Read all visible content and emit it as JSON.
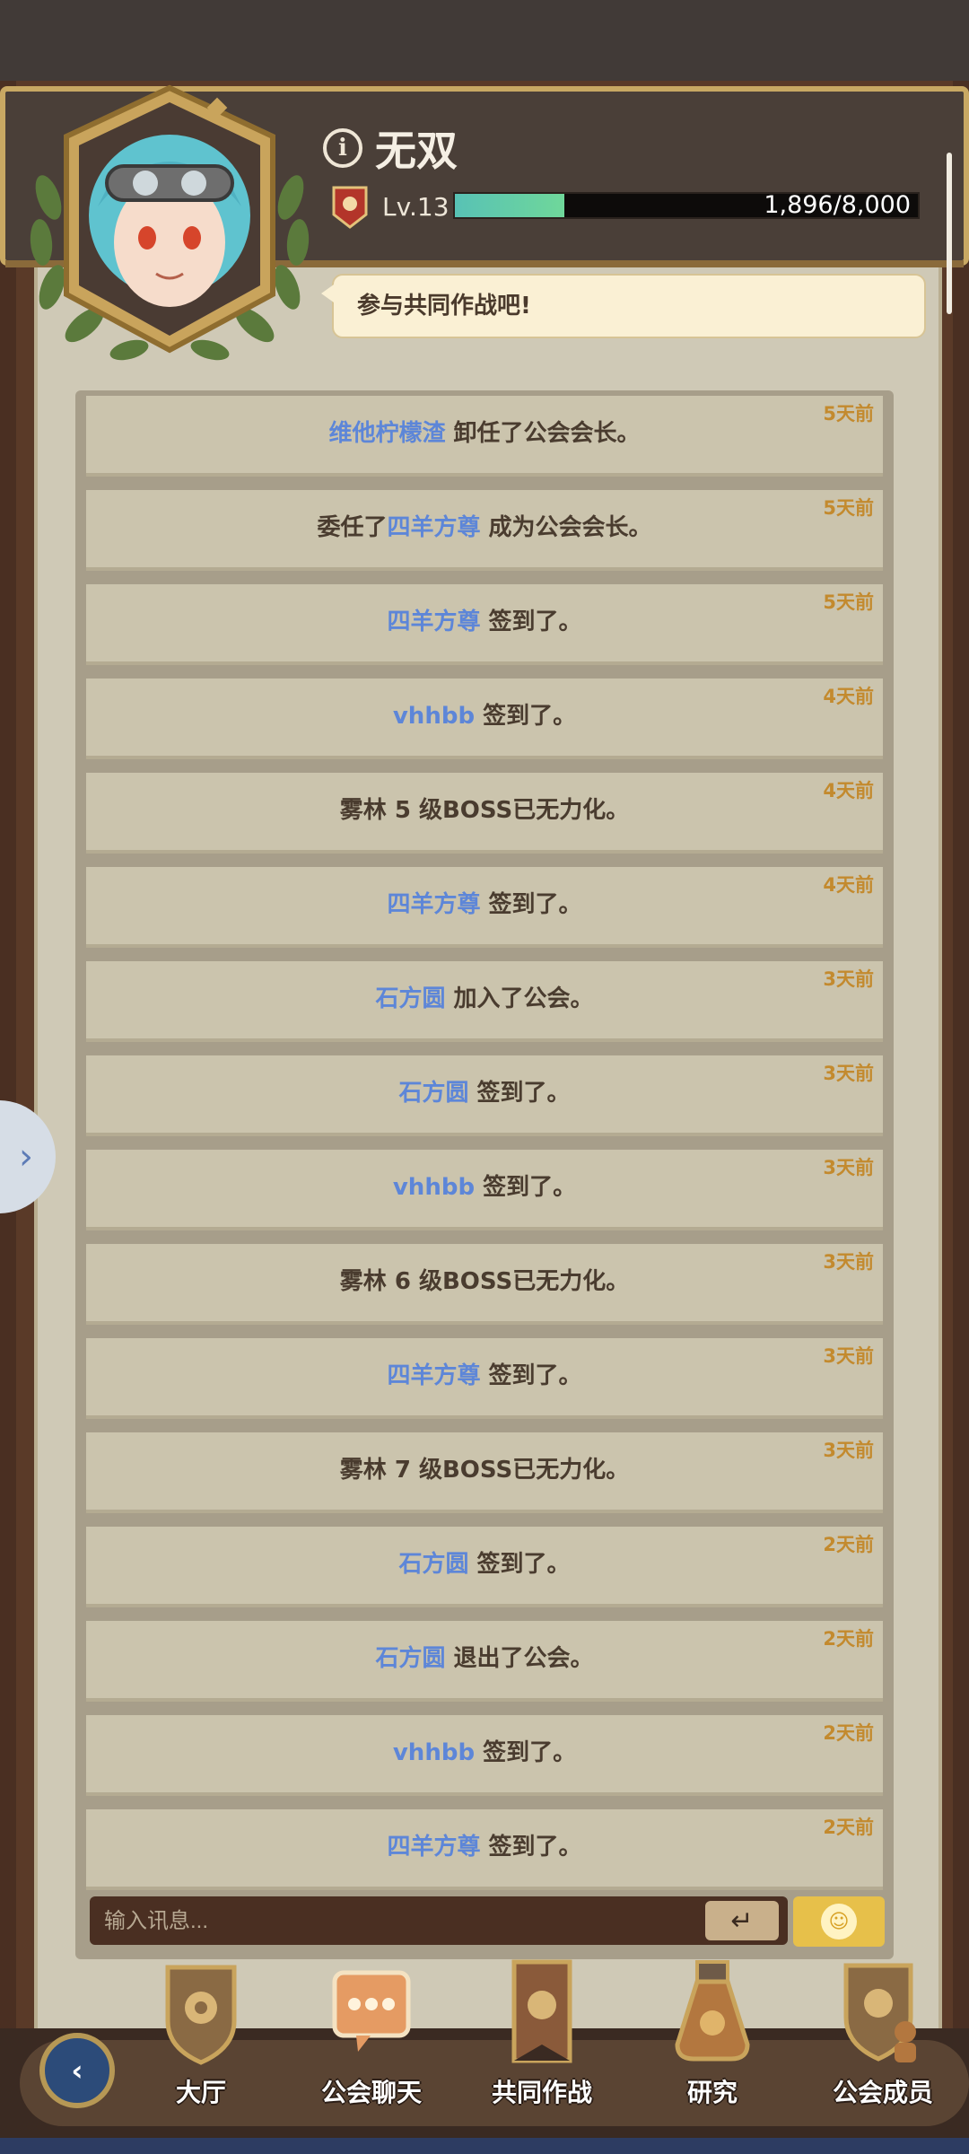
{
  "header": {
    "player_name": "无双",
    "level": "Lv.13",
    "xp_text": "1,896/8,000",
    "xp_fraction": 0.237,
    "speech": "参与共同作战吧!"
  },
  "messages": [
    {
      "who": "维他柠檬渣",
      "pre": "",
      "text": " 卸任了公会会长。",
      "time": "5天前"
    },
    {
      "who": "四羊方尊",
      "pre": "委任了",
      "text": " 成为公会会长。",
      "time": "5天前"
    },
    {
      "who": "四羊方尊",
      "pre": "",
      "text": " 签到了。",
      "time": "5天前"
    },
    {
      "who": "vhhbb",
      "pre": "",
      "text": " 签到了。",
      "time": "4天前"
    },
    {
      "who": "",
      "pre": "",
      "text": "雾林 5 级BOSS已无力化。",
      "time": "4天前"
    },
    {
      "who": "四羊方尊",
      "pre": "",
      "text": " 签到了。",
      "time": "4天前"
    },
    {
      "who": "石方圆",
      "pre": "",
      "text": " 加入了公会。",
      "time": "3天前"
    },
    {
      "who": "石方圆",
      "pre": "",
      "text": " 签到了。",
      "time": "3天前"
    },
    {
      "who": "vhhbb",
      "pre": "",
      "text": " 签到了。",
      "time": "3天前"
    },
    {
      "who": "",
      "pre": "",
      "text": "雾林 6 级BOSS已无力化。",
      "time": "3天前"
    },
    {
      "who": "四羊方尊",
      "pre": "",
      "text": " 签到了。",
      "time": "3天前"
    },
    {
      "who": "",
      "pre": "",
      "text": "雾林 7 级BOSS已无力化。",
      "time": "3天前"
    },
    {
      "who": "石方圆",
      "pre": "",
      "text": " 签到了。",
      "time": "2天前"
    },
    {
      "who": "石方圆",
      "pre": "",
      "text": " 退出了公会。",
      "time": "2天前"
    },
    {
      "who": "vhhbb",
      "pre": "",
      "text": " 签到了。",
      "time": "2天前"
    },
    {
      "who": "四羊方尊",
      "pre": "",
      "text": " 签到了。",
      "time": "2天前"
    }
  ],
  "input": {
    "placeholder": "输入讯息..."
  },
  "nav": {
    "hall": "大厅",
    "guild_chat": "公会聊天",
    "co_op_battle": "共同作战",
    "research": "研究",
    "guild_members": "公会成员"
  },
  "colors": {
    "name_link": "#5d86d8",
    "time": "#c38a2e",
    "xp_fill": "#58c2b5",
    "emoji_button": "#e7c04a"
  },
  "icons": {
    "info": "info-icon",
    "send": "enter-arrow-icon",
    "emoji": "smiley-icon",
    "back": "chevron-left-icon",
    "side": "chevron-right-icon"
  }
}
